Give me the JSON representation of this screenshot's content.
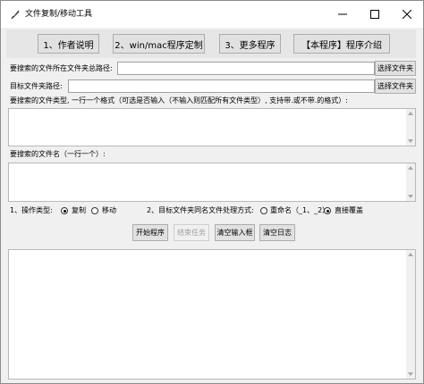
{
  "window": {
    "title": "文件复制/移动工具",
    "controls": {
      "minimize": "—",
      "maximize": "☐",
      "close": "✕"
    }
  },
  "top_buttons": [
    {
      "label": "1、作者说明"
    },
    {
      "label": "2、win/mac程序定制"
    },
    {
      "label": "3、更多程序"
    },
    {
      "label": "【本程序】程序介绍"
    }
  ],
  "source_dir": {
    "label": "要搜索的文件所在文件夹总路径:",
    "value": "",
    "button": "选择文件夹"
  },
  "target_dir": {
    "label": "目标文件夹路径:",
    "value": "",
    "button": "选择文件夹"
  },
  "file_types": {
    "label": "要搜索的文件类型, 一行一个格式（可选是否输入（不输入则匹配所有文件类型）, 支持带.或不带.的格式）:",
    "value": ""
  },
  "file_names": {
    "label": "要搜索的文件名（一行一个）:",
    "value": ""
  },
  "operation": {
    "label": "1、操作类型:",
    "options": [
      "复制",
      "移动"
    ],
    "selected": "复制"
  },
  "conflict": {
    "label": "2、目标文件夹同名文件处理方式:",
    "options": [
      "重命名（_1、_2）",
      "直接覆盖"
    ],
    "selected": "直接覆盖"
  },
  "actions": {
    "start": "开始程序",
    "stop": "结束任务",
    "clear_input": "清空输入框",
    "clear_log": "清空日志"
  },
  "log": {
    "value": ""
  }
}
